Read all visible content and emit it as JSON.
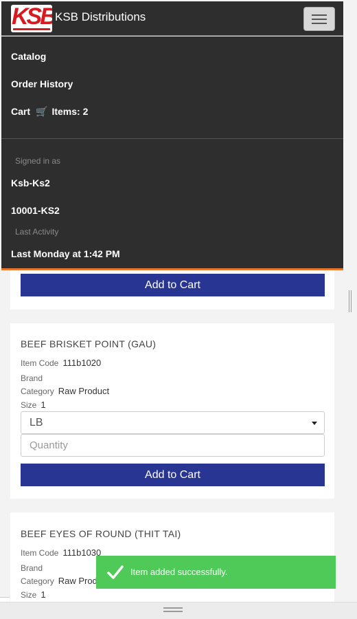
{
  "navbar": {
    "logo_text": "KSB",
    "brand": "KSB Distributions",
    "menu_icon": "hamburger-icon"
  },
  "menu": {
    "catalog": "Catalog",
    "order_history": "Order History",
    "cart_label": "Cart",
    "cart_icon": "shopping-cart-icon",
    "cart_items": "Items: 2",
    "signed_in_label": "Signed in as",
    "user_name": "Ksb-Ks2",
    "account_id": "10001-KS2",
    "last_activity_label": "Last Activity",
    "last_activity": "Last Monday at 1:42 PM"
  },
  "products": [
    {
      "add_label": "Add to Cart"
    },
    {
      "name": "BEEF BRISKET POINT (GAU)",
      "item_code_label": "Item Code",
      "item_code": "111b1020",
      "brand_label": "Brand",
      "brand": "",
      "category_label": "Category",
      "category": "Raw Product",
      "size_label": "Size",
      "size": "1",
      "unit": "LB",
      "quantity_placeholder": "Quantity",
      "add_label": "Add to Cart"
    },
    {
      "name": "BEEF EYES OF ROUND (THIT TAI)",
      "item_code_label": "Item Code",
      "item_code": "111b1030",
      "brand_label": "Brand",
      "brand": "",
      "category_label": "Category",
      "category": "Raw Product",
      "size_label": "Size",
      "size": "1"
    }
  ],
  "toast": {
    "message": "Item added successfully.",
    "icon": "check-icon",
    "color": "#4fca59"
  },
  "colors": {
    "navbar": "#2e2e2e",
    "accent": "#e8772e",
    "button": "#283593"
  }
}
